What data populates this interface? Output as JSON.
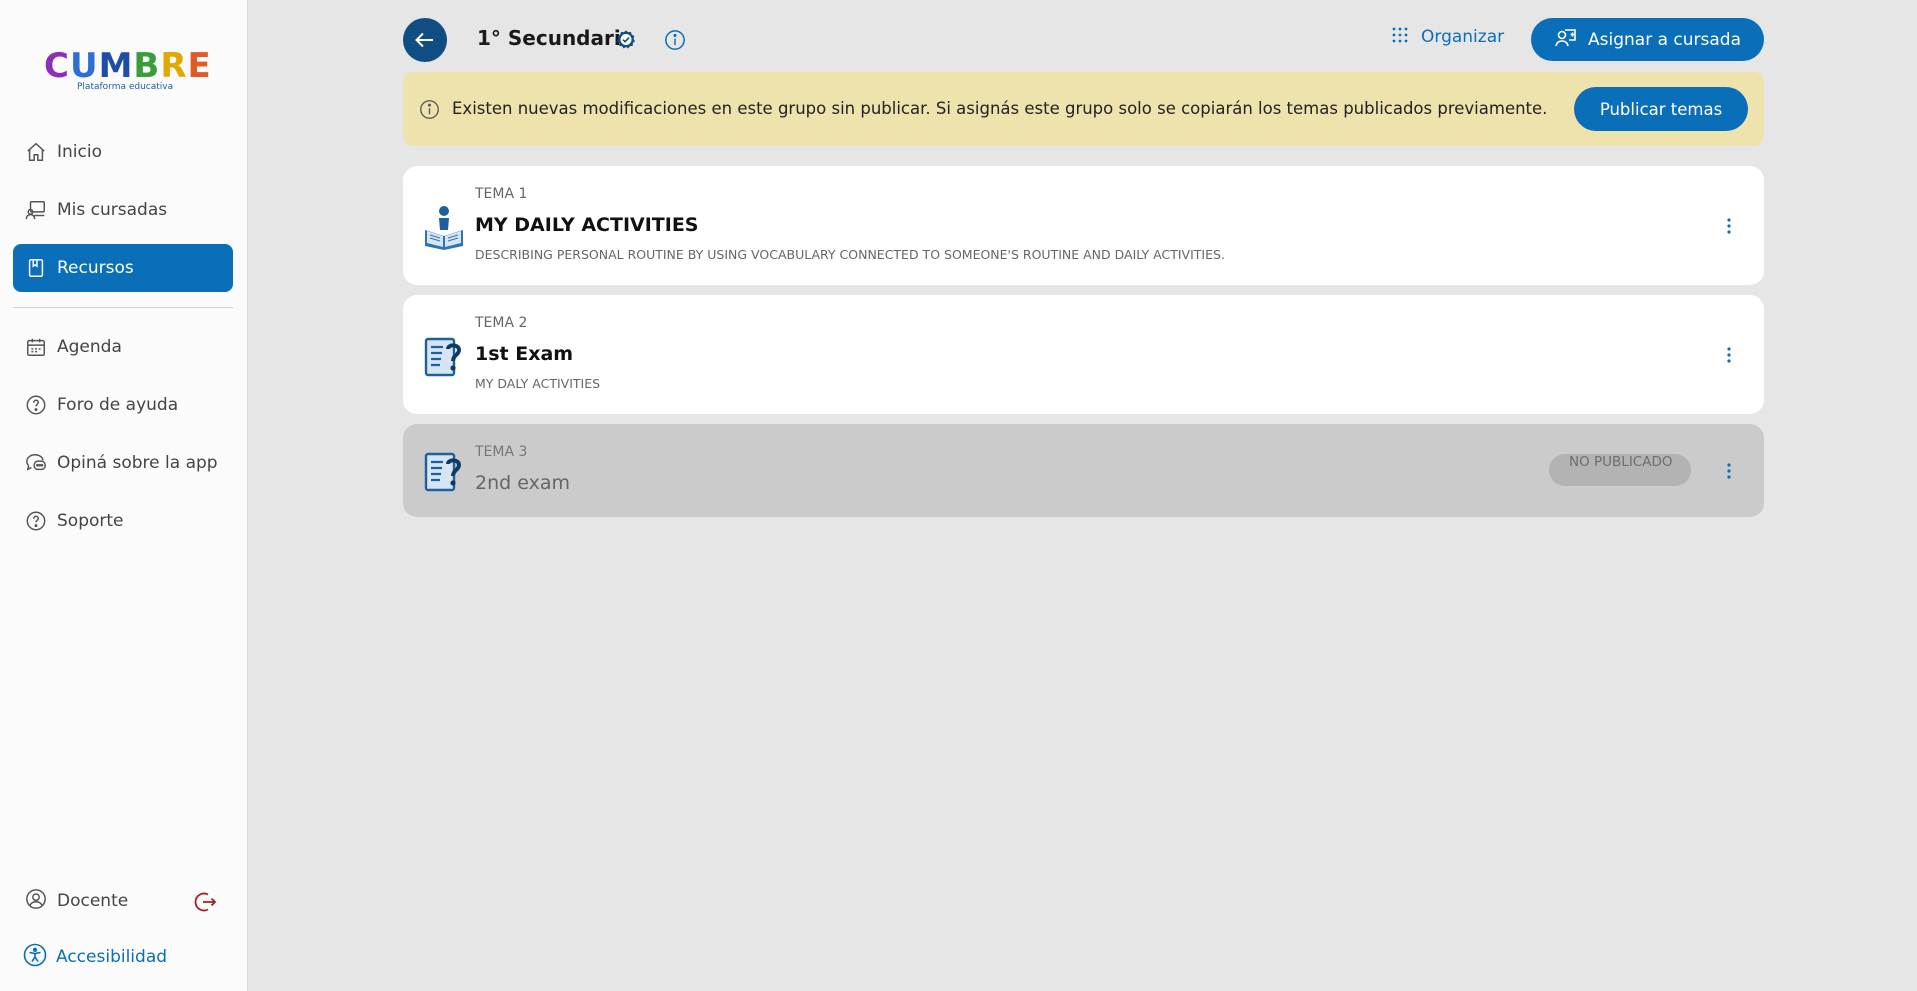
{
  "sidebar": {
    "logo": {
      "word": "CUMBRE",
      "subtitle": "Plataforma educativa",
      "letters": [
        "C",
        "U",
        "M",
        "B",
        "R",
        "E"
      ],
      "letter_colors": [
        "#8c2fb9",
        "#2d6fd6",
        "#1d4da8",
        "#3a9c3a",
        "#e0a800",
        "#e05a24"
      ]
    },
    "items": [
      {
        "label": "Inicio",
        "icon": "home-icon"
      },
      {
        "label": "Mis cursadas",
        "icon": "classroom-icon"
      },
      {
        "label": "Recursos",
        "icon": "book-icon",
        "active": true
      },
      {
        "label": "Agenda",
        "icon": "calendar-icon"
      },
      {
        "label": "Foro de ayuda",
        "icon": "help-circle-icon"
      },
      {
        "label": "Opiná sobre la app",
        "icon": "chat-bubbles-icon"
      },
      {
        "label": "Soporte",
        "icon": "help-circle-icon"
      }
    ],
    "user": {
      "label": "Docente",
      "icon": "user-circle-icon",
      "logout_icon": "logout-icon"
    },
    "accessibility": {
      "label": "Accesibilidad",
      "icon": "accessibility-icon"
    }
  },
  "header": {
    "title": "1° Secundaria",
    "organize_label": "Organizar",
    "assign_label": "Asignar a cursada"
  },
  "banner": {
    "message": "Existen nuevas modificaciones en este grupo sin publicar. Si asignás este grupo solo se copiarán los temas publicados previamente.",
    "button_label": "Publicar temas"
  },
  "topics": [
    {
      "tema": "TEMA 1",
      "title": "MY DAILY ACTIVITIES",
      "description": "DESCRIBING PERSONAL ROUTINE BY USING VOCABULARY CONNECTED TO SOMEONE'S ROUTINE AND DAILY ACTIVITIES.",
      "icon": "reading-book-icon"
    },
    {
      "tema": "TEMA 2",
      "title": "1st Exam",
      "description": "MY DALY ACTIVITIES",
      "icon": "exam-document-icon"
    },
    {
      "tema": "TEMA 3",
      "title": "2nd exam",
      "badge": "NO PUBLICADO",
      "icon": "exam-document-icon",
      "published": false
    }
  ],
  "colors": {
    "primary": "#0a6fb8",
    "dark_primary": "#0f4d82",
    "banner_bg": "#efe3ad",
    "disabled_card": "#cbcbcb"
  }
}
